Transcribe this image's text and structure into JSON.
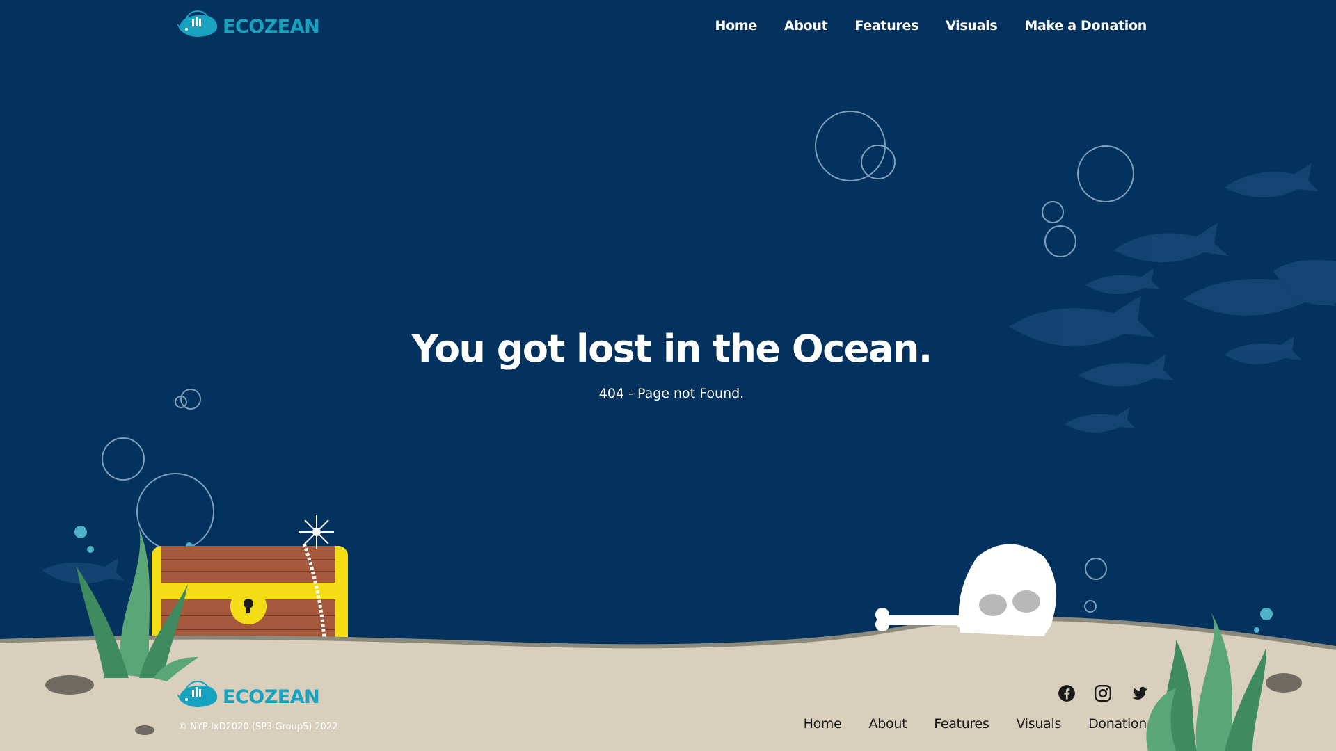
{
  "brand": {
    "name": "ECOZEAN",
    "accent_color": "#17a2c0"
  },
  "header": {
    "nav": [
      {
        "label": "Home"
      },
      {
        "label": "About"
      },
      {
        "label": "Features"
      },
      {
        "label": "Visuals"
      },
      {
        "label": "Make a Donation"
      }
    ]
  },
  "hero": {
    "title": "You got lost in the Ocean.",
    "subtitle": "404 - Page not Found."
  },
  "footer": {
    "copyright": "© NYP-IxD2020 (SP3 Group5) 2022",
    "socials": [
      {
        "icon": "facebook-icon"
      },
      {
        "icon": "instagram-icon"
      },
      {
        "icon": "twitter-icon"
      }
    ],
    "nav": [
      {
        "label": "Home"
      },
      {
        "label": "About"
      },
      {
        "label": "Features"
      },
      {
        "label": "Visuals"
      },
      {
        "label": "Donation"
      }
    ]
  },
  "colors": {
    "ocean": "#03325f",
    "sand": "#d8cfbd",
    "seaweed": "#5aa676",
    "chest_wood": "#a5583b",
    "chest_gold": "#f4dd16"
  }
}
